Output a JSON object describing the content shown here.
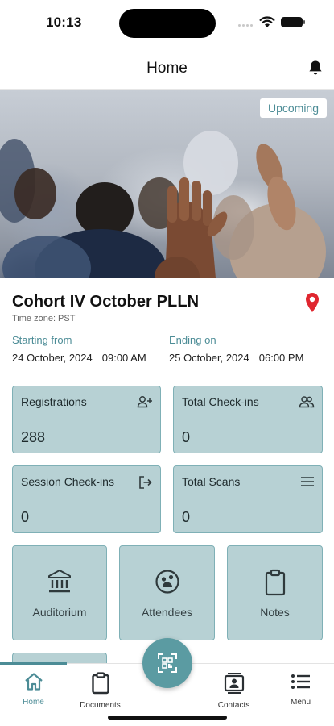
{
  "status_bar": {
    "time": "10:13"
  },
  "header": {
    "title": "Home"
  },
  "hero": {
    "badge": "Upcoming"
  },
  "event": {
    "title": "Cohort IV October PLLN",
    "timezone": "Time zone: PST",
    "start": {
      "label": "Starting from",
      "date": "24 October, 2024",
      "time": "09:00 AM"
    },
    "end": {
      "label": "Ending on",
      "date": "25 October, 2024",
      "time": "06:00 PM"
    }
  },
  "stats": [
    {
      "label": "Registrations",
      "value": "288",
      "icon": "add-person-icon"
    },
    {
      "label": "Total Check-ins",
      "value": "0",
      "icon": "group-icon"
    },
    {
      "label": "Session Check-ins",
      "value": "0",
      "icon": "login-icon"
    },
    {
      "label": "Total Scans",
      "value": "0",
      "icon": "menu-lines-icon"
    }
  ],
  "tiles": [
    {
      "label": "Auditorium",
      "icon": "building-icon"
    },
    {
      "label": "Attendees",
      "icon": "face-icon"
    },
    {
      "label": "Notes",
      "icon": "clipboard-icon"
    }
  ],
  "tabbar": {
    "items": [
      {
        "label": "Home",
        "icon": "home-icon"
      },
      {
        "label": "Documents",
        "icon": "clipboard-icon"
      },
      {
        "label": "Contacts",
        "icon": "contacts-icon"
      },
      {
        "label": "Menu",
        "icon": "menu-icon"
      }
    ],
    "fab_icon": "qr-scan-icon"
  },
  "colors": {
    "accent": "#4c8c96",
    "card": "#b7d1d4",
    "card_border": "#7fb0b6",
    "pin": "#e0262f"
  }
}
